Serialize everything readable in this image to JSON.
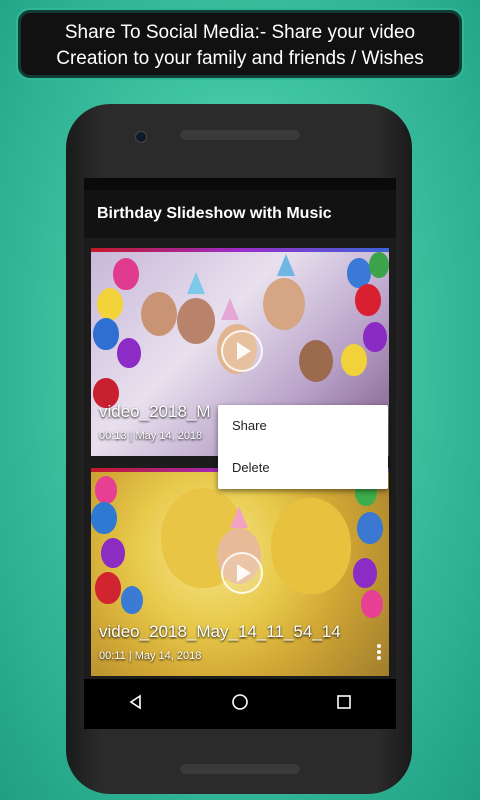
{
  "banner": {
    "line1": "Share To Social Media:-  Share your video",
    "line2": "Creation to your family and friends / Wishes"
  },
  "app": {
    "title": "Birthday Slideshow with Music"
  },
  "videos": [
    {
      "title": "video_2018_M",
      "duration": "00:13",
      "date": "May 14, 2018"
    },
    {
      "title": "video_2018_May_14_11_54_14",
      "duration": "00:11",
      "date": "May 14, 2018"
    }
  ],
  "context_menu": {
    "items": [
      "Share",
      "Delete"
    ]
  },
  "colors": {
    "accent_border": "#2fb896",
    "appbar": "#121212",
    "background": "#3fc4a3"
  },
  "icons": {
    "back": "back-triangle-icon",
    "home": "home-circle-icon",
    "recents": "recents-square-icon",
    "play": "play-icon",
    "more": "more-vertical-icon"
  }
}
